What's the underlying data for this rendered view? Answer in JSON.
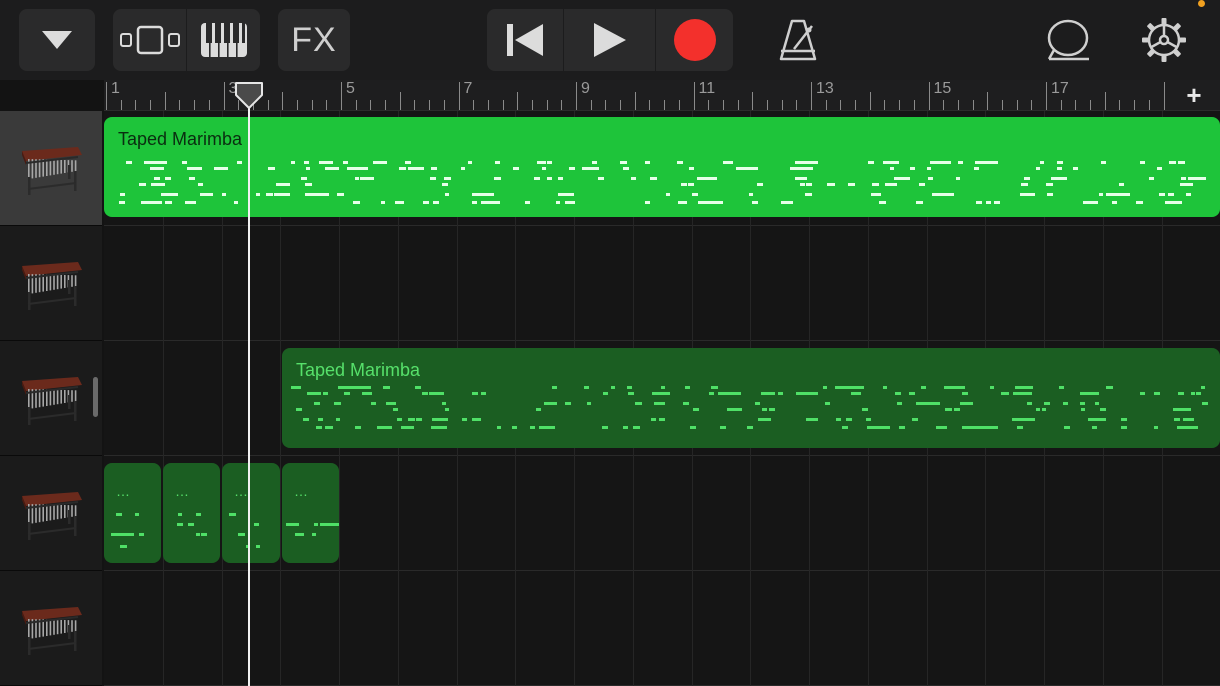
{
  "toolbar": {
    "fx_label": "FX",
    "icons": {
      "browser": "chevron-down-icon",
      "tracks_view": "tracks-view-icon",
      "instrument": "piano-keys-icon",
      "fx": "fx-icon",
      "rewind": "skip-to-start-icon",
      "play": "play-icon",
      "record": "record-icon",
      "metronome": "metronome-icon",
      "loop": "loop-browser-icon",
      "settings": "gear-icon"
    },
    "record_color": "#f3302c"
  },
  "ruler": {
    "bar_labels": [
      "1",
      "3",
      "5",
      "7",
      "9",
      "11",
      "13",
      "15",
      "17"
    ]
  },
  "tracks": [
    {
      "instrument_icon": "marimba-icon",
      "selected": true
    },
    {
      "instrument_icon": "marimba-icon",
      "selected": false
    },
    {
      "instrument_icon": "marimba-icon",
      "selected": false
    },
    {
      "instrument_icon": "marimba-icon",
      "selected": false
    },
    {
      "instrument_icon": "marimba-icon",
      "selected": false
    }
  ],
  "regions": [
    {
      "track": 1,
      "title": "Taped Marimba",
      "style": "bright"
    },
    {
      "track": 3,
      "title": "Taped Marimba",
      "style": "dark"
    },
    {
      "track": 4,
      "title": "",
      "style": "dark"
    },
    {
      "track": 4,
      "title": "",
      "style": "dark"
    },
    {
      "track": 4,
      "title": "",
      "style": "dark"
    },
    {
      "track": 4,
      "title": "",
      "style": "dark"
    }
  ],
  "colors": {
    "region_bright": "#1ec43a",
    "region_dark": "#1b5e22",
    "accent_dot": "#f0a020"
  }
}
